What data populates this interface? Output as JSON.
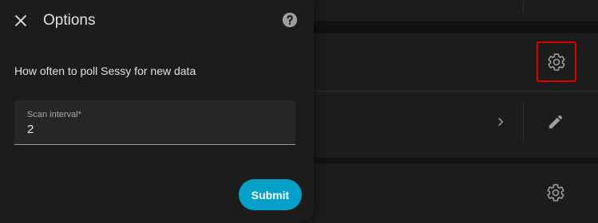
{
  "dialog": {
    "title": "Options",
    "description": "How often to poll Sessy for new data",
    "field": {
      "label": "Scan interval*",
      "value": "2"
    },
    "submit_label": "Submit",
    "icons": {
      "close": "close-icon",
      "help": "help-icon"
    }
  },
  "background": {
    "icons": [
      "gear-icon",
      "chevron-right-icon",
      "pencil-icon",
      "gear-icon"
    ],
    "colors": {
      "highlight": "#e00000",
      "accent": "#05a0c8"
    }
  }
}
